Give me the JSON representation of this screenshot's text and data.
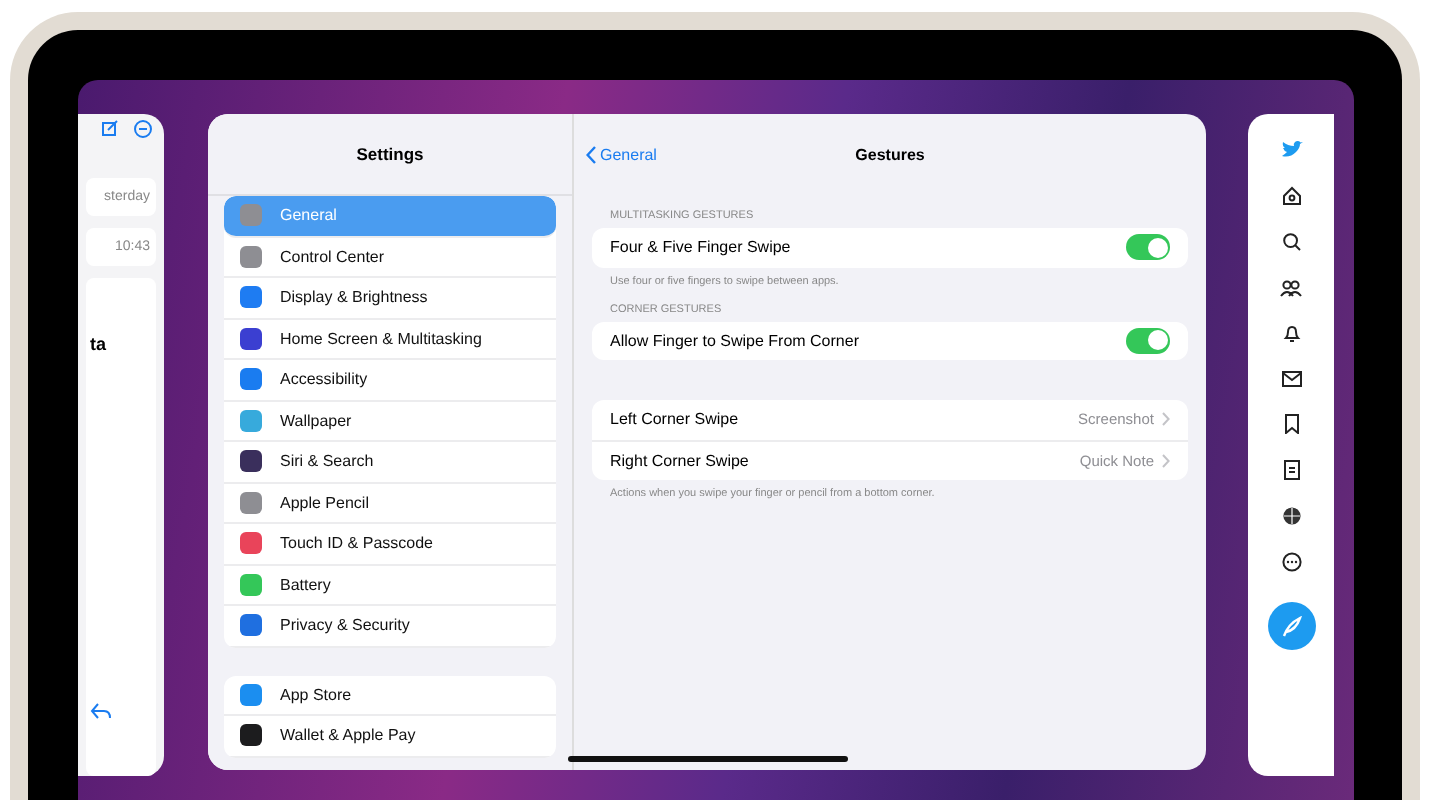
{
  "mail_preview": {
    "snippets": [
      "sterday",
      "10:43"
    ],
    "subject": "ta"
  },
  "settings": {
    "title": "Settings",
    "groups": [
      [
        {
          "label": "General",
          "color": "#8e8e93",
          "selected": true
        },
        {
          "label": "Control Center",
          "color": "#8e8e93",
          "selected": false
        },
        {
          "label": "Display & Brightness",
          "color": "#1e7cf2",
          "selected": false
        },
        {
          "label": "Home Screen & Multitasking",
          "color": "#3b3fd1",
          "selected": false
        },
        {
          "label": "Accessibility",
          "color": "#1a7cf0",
          "selected": false
        },
        {
          "label": "Wallpaper",
          "color": "#37aadc",
          "selected": false
        },
        {
          "label": "Siri & Search",
          "color": "#3a2f5c",
          "selected": false
        },
        {
          "label": "Apple Pencil",
          "color": "#8e8e93",
          "selected": false
        },
        {
          "label": "Touch ID & Passcode",
          "color": "#e9445a",
          "selected": false
        },
        {
          "label": "Battery",
          "color": "#34c759",
          "selected": false
        },
        {
          "label": "Privacy & Security",
          "color": "#1f6fe0",
          "selected": false
        }
      ],
      [
        {
          "label": "App Store",
          "color": "#1b8ef0",
          "selected": false
        },
        {
          "label": "Wallet & Apple Pay",
          "color": "#1c1c1e",
          "selected": false
        }
      ]
    ]
  },
  "detail": {
    "back": "General",
    "title": "Gestures",
    "sections": [
      {
        "header": "MULTITASKING GESTURES",
        "rows": [
          {
            "kind": "toggle",
            "label": "Four & Five Finger Swipe",
            "on": true
          }
        ],
        "footer": "Use four or five fingers to swipe between apps."
      },
      {
        "header": "CORNER GESTURES",
        "rows": [
          {
            "kind": "toggle",
            "label": "Allow Finger to Swipe From Corner",
            "on": true
          }
        ]
      },
      {
        "rows": [
          {
            "kind": "link",
            "label": "Left Corner Swipe",
            "value": "Screenshot"
          },
          {
            "kind": "link",
            "label": "Right Corner Swipe",
            "value": "Quick Note"
          }
        ],
        "footer": "Actions when you swipe your finger or pencil from a bottom corner."
      }
    ]
  }
}
